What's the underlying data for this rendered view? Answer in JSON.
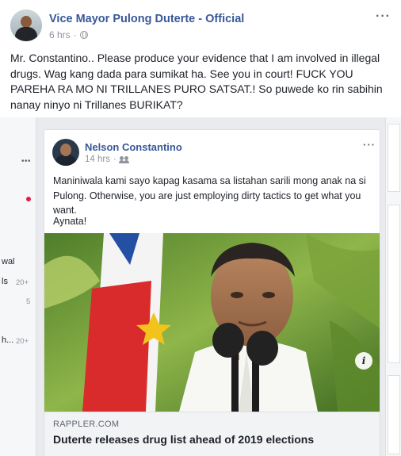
{
  "post": {
    "author": "Vice Mayor Pulong Duterte - Official",
    "time": "6 hrs",
    "privacy_icon": "globe-icon",
    "more_icon": "more-options-icon",
    "text": "Mr. Constantino.. Please produce your evidence that I am involved in illegal drugs. Wag kang dada para sumikat ha. See you in court! FUCK YOU PAREHA RA MO NI TRILLANES PURO SATSAT.! So puwede ko rin sabihin nanay ninyo ni Trillanes BURIKAT?"
  },
  "shared_post": {
    "author": "Nelson Constantino",
    "time": "14 hrs",
    "privacy_icon": "friends-icon",
    "text": "Maniniwala kami sayo kapag kasama sa listahan sarili mong anak na si Pulong. Otherwise, you are just employing dirty tactics to get what you want.",
    "text2": "Aynata!",
    "link": {
      "domain": "RAPPLER.COM",
      "title": "Duterte releases drug list ahead of 2019 elections",
      "info_icon": "info-icon",
      "info_glyph": "i"
    }
  },
  "background_feed": {
    "more_glyph": "•••",
    "left_texts": [
      "wal",
      "ls",
      "...",
      "h..."
    ],
    "left_counts": [
      "20+",
      "5",
      "20+"
    ]
  },
  "colors": {
    "link_blue": "#385898",
    "meta_gray": "#90949c",
    "feed_bg": "#e9ebee",
    "notification_red": "#e41e3f"
  }
}
